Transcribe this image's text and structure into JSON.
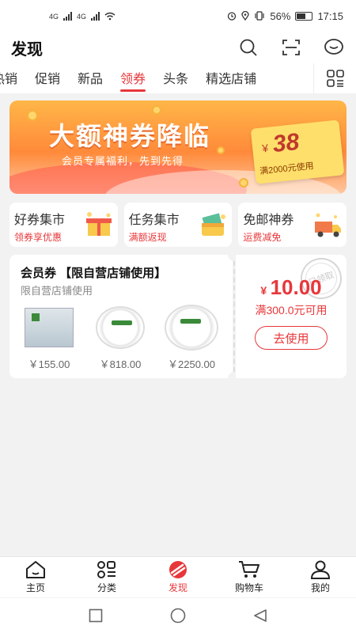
{
  "status_bar": {
    "signal_1": "4G",
    "signal_2": "4G",
    "battery": "56%",
    "time": "17:15"
  },
  "header": {
    "title": "发现"
  },
  "tabs": [
    {
      "label": "热销"
    },
    {
      "label": "促销"
    },
    {
      "label": "新品"
    },
    {
      "label": "领券"
    },
    {
      "label": "头条"
    },
    {
      "label": "精选店铺"
    }
  ],
  "banner": {
    "title": "大额神券降临",
    "subtitle": "会员专属福利，先到先得",
    "currency": "¥",
    "amount": "38",
    "condition": "满2000元使用"
  },
  "mini_cards": [
    {
      "title": "好券集市",
      "subtitle": "领券享优惠"
    },
    {
      "title": "任务集市",
      "subtitle": "满额返现"
    },
    {
      "title": "免邮神券",
      "subtitle": "运费减免"
    }
  ],
  "coupon": {
    "title": "会员券 【限自营店铺使用】",
    "description": "限自营店铺使用",
    "products": [
      {
        "price": "￥155.00"
      },
      {
        "price": "￥818.00"
      },
      {
        "price": "￥2250.00"
      }
    ],
    "currency": "¥",
    "amount": "10.00",
    "condition": "满300.0元可用",
    "button": "去使用",
    "stamp": "已领取"
  },
  "bottom_nav": [
    {
      "label": "主页"
    },
    {
      "label": "分类"
    },
    {
      "label": "发现"
    },
    {
      "label": "购物车"
    },
    {
      "label": "我的"
    }
  ],
  "colors": {
    "accent": "#e8373a",
    "banner": "#ff9a3c",
    "background": "#f2f2f2"
  }
}
